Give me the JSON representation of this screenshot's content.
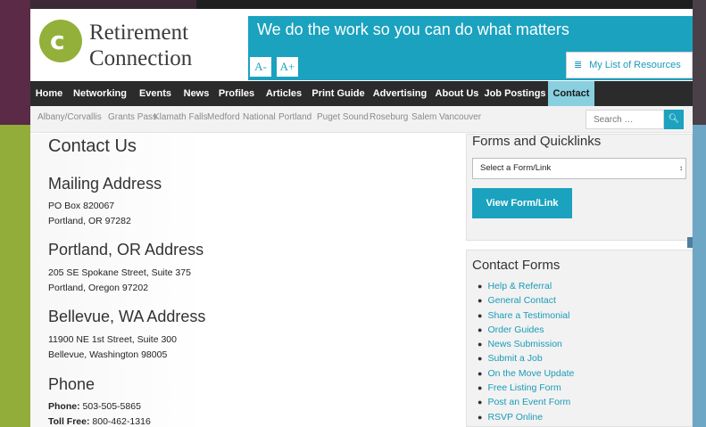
{
  "header": {
    "logo_line1": "Retirement",
    "logo_line2": "Connection",
    "logo_glyph": "c",
    "tagline": "We do the work so you can do what matters",
    "font_decrease_label": "A-",
    "font_increase_label": "A+",
    "resources_label": "My List of Resources"
  },
  "nav": {
    "items": [
      {
        "label": "Home"
      },
      {
        "label": "Networking"
      },
      {
        "label": "Events"
      },
      {
        "label": "News"
      },
      {
        "label": "Profiles"
      },
      {
        "label": "Articles"
      },
      {
        "label": "Print Guide"
      },
      {
        "label": "Advertising"
      },
      {
        "label": "About Us"
      },
      {
        "label": "Job Postings"
      },
      {
        "label": "Contact"
      }
    ],
    "active": "Contact"
  },
  "cities": [
    "Albany/Corvallis",
    "Grants Pass",
    "Klamath Falls",
    "Medford",
    "National",
    "Portland",
    "Puget Sound",
    "Roseburg",
    "Salem",
    "Vancouver"
  ],
  "search": {
    "placeholder": "Search …"
  },
  "main": {
    "title": "Contact Us",
    "mailing": {
      "heading": "Mailing Address",
      "line1": "PO Box 820067",
      "line2": "Portland, OR 97282"
    },
    "portland": {
      "heading": "Portland, OR Address",
      "line1": "205 SE Spokane Street, Suite 375",
      "line2": "Portland, Oregon 97202"
    },
    "bellevue": {
      "heading": "Bellevue, WA Address",
      "line1": "11900 NE 1st Street, Suite 300",
      "line2": "Bellevue, Washington 98005"
    },
    "phone": {
      "heading": "Phone",
      "phone_label": "Phone:",
      "phone_value": "503-505-5865",
      "tollfree_label": "Toll Free:",
      "tollfree_value": "800-462-1316"
    }
  },
  "sidebar": {
    "forms_title": "Forms and Quicklinks",
    "select_value": "Select a Form/Link",
    "view_button": "View Form/Link",
    "contact_forms_title": "Contact Forms",
    "contact_forms": [
      "Help & Referral",
      "General Contact",
      "Share a Testimonial",
      "Order Guides",
      "News Submission",
      "Submit a Job",
      "On the Move Update",
      "Free Listing Form",
      "Post an Event Form",
      "RSVP Online"
    ]
  },
  "colors": {
    "brand_teal": "#1aa2bf",
    "brand_green": "#93b03a",
    "nav_bg": "#2b2b2b",
    "nav_active": "#88cfe0",
    "link": "#1a9bb8"
  }
}
